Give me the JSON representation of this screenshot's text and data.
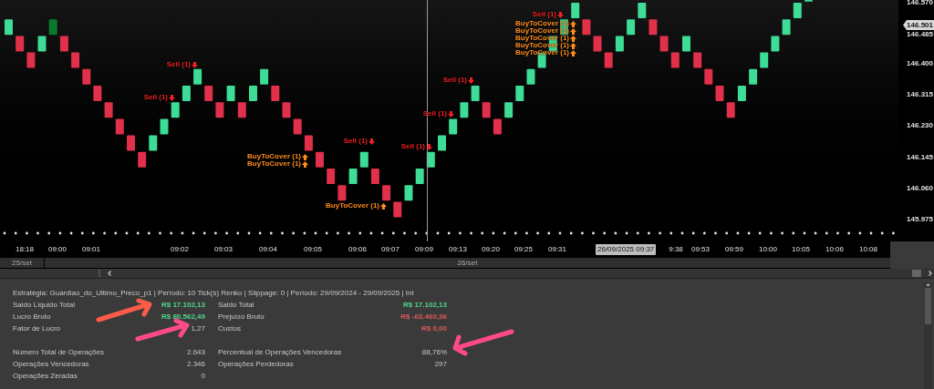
{
  "chart": {
    "price_ticks": [
      "146.570",
      "146.485",
      "146.400",
      "146.315",
      "146.230",
      "146.145",
      "146.060",
      "145.975"
    ],
    "current_price": "146.501",
    "signals": [
      {
        "kind": "sell",
        "label": "Sell (1)"
      },
      {
        "kind": "sell",
        "label": "Sell (1)"
      },
      {
        "kind": "cover",
        "label": "BuyToCover (1)"
      },
      {
        "kind": "cover",
        "label": "BuyToCover (1)"
      },
      {
        "kind": "sell",
        "label": "Sell (1)"
      },
      {
        "kind": "cover",
        "label": "BuyToCover (1)"
      },
      {
        "kind": "sell",
        "label": "Sell (1)"
      },
      {
        "kind": "sell",
        "label": "Sell (1)"
      },
      {
        "kind": "sell",
        "label": "Sell (1)"
      },
      {
        "kind": "sell",
        "label": "Sell (1)"
      },
      {
        "kind": "cover",
        "label": "BuyToCover (1)"
      },
      {
        "kind": "cover",
        "label": "BuyToCover (1)"
      },
      {
        "kind": "cover",
        "label": "BuyToCover (1)"
      },
      {
        "kind": "cover",
        "label": "BuyToCover (1)"
      },
      {
        "kind": "cover",
        "label": "BuyToCover (1)"
      }
    ],
    "time_labels": [
      "18:18",
      "09:00",
      "09:01",
      "09:02",
      "09:03",
      "09:04",
      "09:05",
      "09:06",
      "09:07",
      "09:09",
      "09:13",
      "09:20",
      "09:25",
      "09:31",
      "9:38",
      "09:53",
      "09:59",
      "10:00",
      "10:05",
      "10:06",
      "10:08"
    ],
    "crosshair_time": "26/09/2025 09:37",
    "dates": [
      "25/set",
      "26/set"
    ]
  },
  "report": {
    "header": "Estratégia: Guardiao_do_Ultimo_Preco_p1 | Período: 10 Tick(s) Renko | Slippage: 0 | Período: 29/09/2024 - 29/09/2025 | Int",
    "sections": [
      {
        "rows": [
          [
            {
              "label": "Saldo Líquido Total",
              "value": "R$ 17.102,13",
              "color": "#4fd68c"
            },
            {
              "label": "Saldo Total",
              "value": "R$ 17.102,13",
              "color": "#4fd68c"
            }
          ],
          [
            {
              "label": "Lucro Bruto",
              "value": "R$ 80.562,49",
              "color": "#4fd68c"
            },
            {
              "label": "Prejuízo Bruto",
              "value": "R$ -63.460,36",
              "color": "#e05a5a"
            }
          ],
          [
            {
              "label": "Fator de Lucro",
              "value": "1,27"
            },
            {
              "label": "Custos",
              "value": "R$ 0,00",
              "color": "#e05a5a"
            }
          ]
        ]
      },
      {
        "rows": [
          [
            {
              "label": "Número Total de Operações",
              "value": "2.643"
            },
            {
              "label": "Percentual de Operações Vencedoras",
              "value": "88,76%"
            }
          ],
          [
            {
              "label": "Operações Vencedoras",
              "value": "2.346"
            },
            {
              "label": "Operações Perdedoras",
              "value": "297"
            }
          ],
          [
            {
              "label": "Operações Zeradas",
              "value": "0"
            }
          ]
        ]
      }
    ]
  }
}
